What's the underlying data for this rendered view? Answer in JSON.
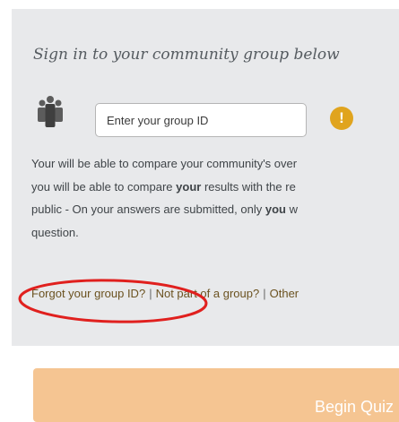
{
  "signin": {
    "title": "Sign in to your community group below",
    "input_placeholder": "Enter your group ID",
    "warning_glyph": "!",
    "description": {
      "line1": "Your will be able to compare your community's over",
      "line2_pre": "you will be able to compare ",
      "line2_bold": "your",
      "line2_post": " results with the re",
      "line3_pre": "public - On your answers are submitted, only ",
      "line3_bold": "you",
      "line3_post": " w",
      "line4": "question."
    },
    "links": {
      "forgot": "Forgot your group ID?",
      "separator": "|",
      "not_part": "Not part of a group?",
      "other": "Other"
    }
  },
  "actions": {
    "begin_label": "Begin Quiz"
  },
  "icons": {
    "group": "group-people-icon",
    "warning": "warning-exclamation-icon"
  },
  "colors": {
    "panel_bg": "#e8e9eb",
    "warning": "#e0a41e",
    "begin_button": "#f5c592",
    "annotation": "#e0201e"
  }
}
